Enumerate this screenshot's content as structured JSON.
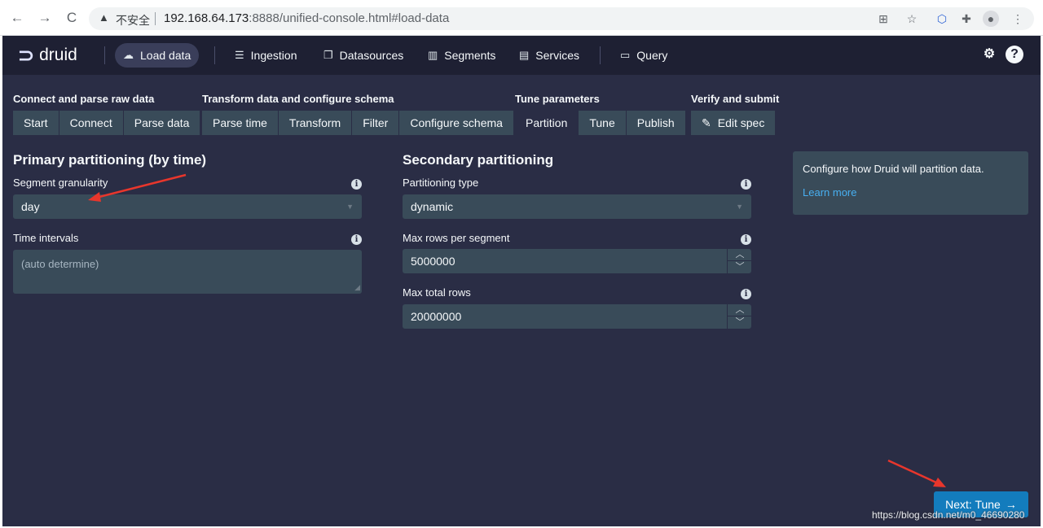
{
  "browser": {
    "back": "←",
    "forward": "→",
    "reload": "C",
    "insecure_label": "不安全",
    "url_host": "192.168.64.173",
    "url_rest": ":8888/unified-console.html#load-data"
  },
  "app": {
    "logo": "druid",
    "nav": {
      "load_data": "Load data",
      "ingestion": "Ingestion",
      "datasources": "Datasources",
      "segments": "Segments",
      "services": "Services",
      "query": "Query"
    },
    "steps": {
      "group1": {
        "title": "Connect and parse raw data",
        "buttons": [
          "Start",
          "Connect",
          "Parse data"
        ]
      },
      "group2": {
        "title": "Transform data and configure schema",
        "buttons": [
          "Parse time",
          "Transform",
          "Filter",
          "Configure schema"
        ]
      },
      "group3": {
        "title": "Tune parameters",
        "buttons": [
          "Partition",
          "Tune",
          "Publish"
        ],
        "active": "Partition"
      },
      "group4": {
        "title": "Verify and submit",
        "buttons": [
          "Edit spec"
        ]
      }
    },
    "primary": {
      "title": "Primary partitioning (by time)",
      "granularity_label": "Segment granularity",
      "granularity_value": "day",
      "intervals_label": "Time intervals",
      "intervals_placeholder": "(auto determine)"
    },
    "secondary": {
      "title": "Secondary partitioning",
      "type_label": "Partitioning type",
      "type_value": "dynamic",
      "max_rows_segment_label": "Max rows per segment",
      "max_rows_segment_value": "5000000",
      "max_total_rows_label": "Max total rows",
      "max_total_rows_value": "20000000"
    },
    "info_panel": {
      "text": "Configure how Druid will partition data.",
      "link": "Learn more"
    },
    "next_button": "Next: Tune"
  },
  "watermark": "https://blog.csdn.net/m0_46690280",
  "colors": {
    "nav_bg": "#1e2033",
    "page_bg": "#2a2d45",
    "control_bg": "#394b59",
    "primary_button": "#137cbd",
    "link": "#48aff0",
    "annotation_arrow": "#e8362c"
  }
}
